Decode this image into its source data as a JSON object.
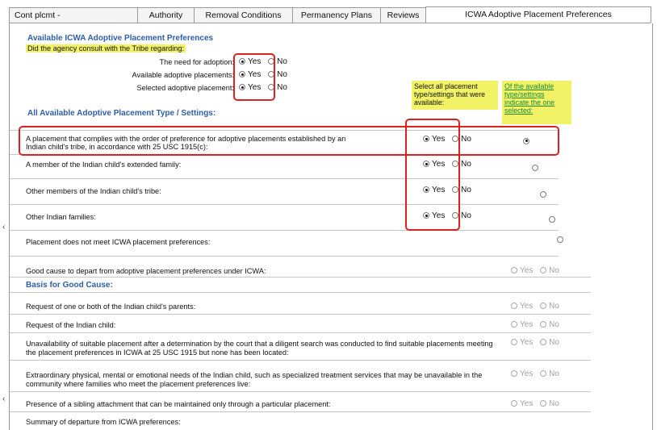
{
  "tabs": [
    {
      "label": "Cont plcmt -"
    },
    {
      "label": "Authority"
    },
    {
      "label": "Removal Conditions"
    },
    {
      "label": "Permanency Plans"
    },
    {
      "label": "Reviews"
    },
    {
      "label": "ICWA Adoptive Placement Preferences"
    }
  ],
  "consult": {
    "title": "Available ICWA Adoptive Placement Preferences",
    "question": "Did the agency consult with the Tribe regarding:",
    "items": [
      {
        "label": "The need for adoption:",
        "selected": "Yes"
      },
      {
        "label": "Available adoptive placements:",
        "selected": "Yes"
      },
      {
        "label": "Selected adoptive placement:",
        "selected": "Yes"
      }
    ]
  },
  "radio_labels": {
    "yes": "Yes",
    "no": "No"
  },
  "settings": {
    "title": "All Available Adoptive Placement Type / Settings:",
    "col_available": "Select all placement type/settings that were available:",
    "col_selected": "Of the available type/settings indicate the one selected:",
    "rows": [
      {
        "label": "A placement that complies with the order of preference for adoptive placements established by an Indian child's tribe, in accordance with 25 USC 1915(c):",
        "available": "Yes",
        "selected": true
      },
      {
        "label": "A member of the Indian child's extended family:",
        "available": "Yes",
        "selected": false
      },
      {
        "label": "Other members of the Indian child's tribe:",
        "available": "Yes",
        "selected": false
      },
      {
        "label": "Other Indian families:",
        "available": "Yes",
        "selected": false
      },
      {
        "label": "Placement does not meet ICWA placement preferences:",
        "available": null,
        "selected": false
      }
    ]
  },
  "good_cause": {
    "label": "Good cause to depart from adoptive placement preferences under ICWA:",
    "basis_title": "Basis for Good Cause:",
    "items": [
      {
        "label": "Request of one or both of the Indian child's parents:"
      },
      {
        "label": "Request of the Indian child:"
      },
      {
        "label": "Unavailability of suitable placement after a determination by the court that a diligent search was conducted to find suitable placements meeting the placement preferences in ICWA at 25 USC 1915 but none has been located:"
      },
      {
        "label": "Extraordinary physical, mental or emotional needs of the Indian child, such as specialized treatment services that may be unavailable in the community where families who meet the placement preferences live:"
      },
      {
        "label": "Presence of a sibling attachment that can be maintained only through a particular placement:"
      }
    ],
    "summary_label": "Summary of departure from ICWA preferences:"
  },
  "colors": {
    "highlight": "#f2f266",
    "annotation_red": "#e0201e",
    "section_blue": "#2e5ea8",
    "link_green": "#1a8a3a"
  }
}
